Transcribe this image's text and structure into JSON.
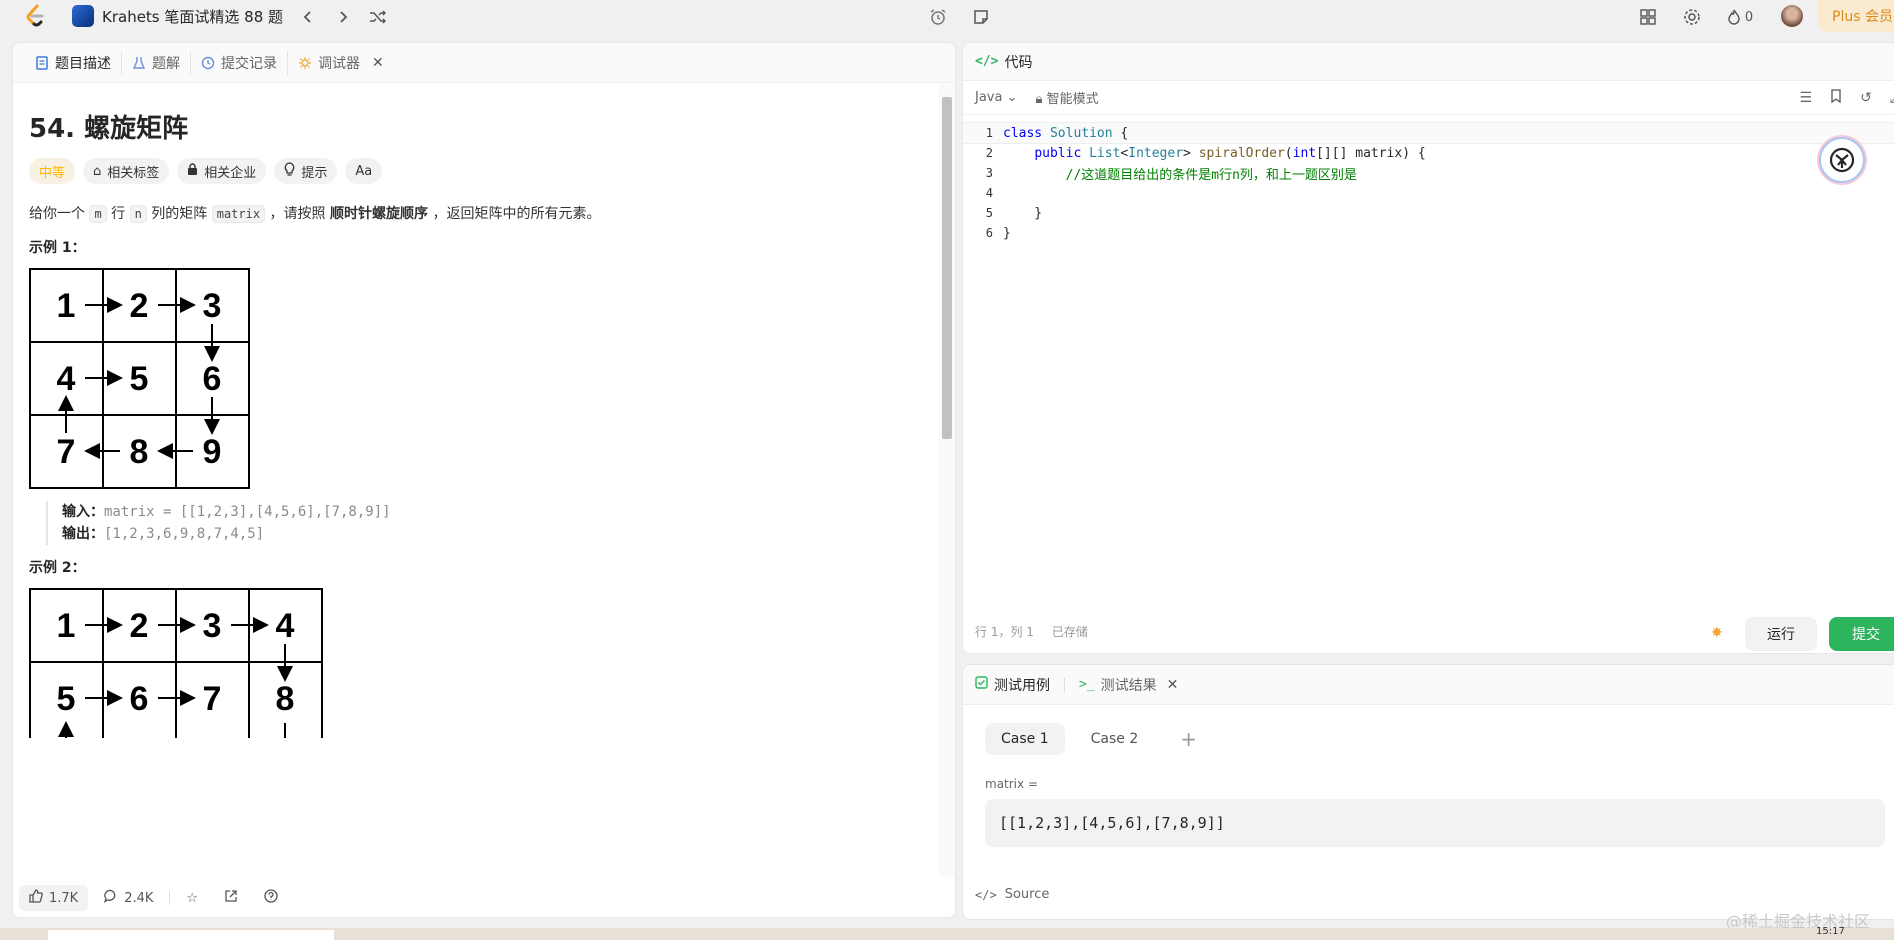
{
  "topbar": {
    "list_title": "Krahets 笔面试精选 88 题",
    "streak_count": "0",
    "plus_label": "Plus 会员"
  },
  "left_tabs": [
    {
      "label": "题目描述",
      "icon": "description-icon"
    },
    {
      "label": "题解",
      "icon": "flask-icon"
    },
    {
      "label": "提交记录",
      "icon": "history-icon"
    },
    {
      "label": "调试器",
      "icon": "debugger-icon"
    }
  ],
  "problem": {
    "title": "54. 螺旋矩阵",
    "difficulty": "中等",
    "badges": [
      "相关标签",
      "相关企业",
      "提示"
    ],
    "font_badge": "Aa",
    "desc_pre": "给你一个",
    "desc_m": "m",
    "desc_mid1": "行",
    "desc_n": "n",
    "desc_mid2": "列的矩阵",
    "desc_matrix": "matrix",
    "desc_mid3": "，请按照",
    "desc_bold": "顺时针螺旋顺序",
    "desc_post": "，返回矩阵中的所有元素。"
  },
  "example1": {
    "heading": "示例 1：",
    "grid": [
      "1",
      "2",
      "3",
      "4",
      "5",
      "6",
      "7",
      "8",
      "9"
    ],
    "input_label": "输入：",
    "input_value": "matrix = [[1,2,3],[4,5,6],[7,8,9]]",
    "output_label": "输出：",
    "output_value": "[1,2,3,6,9,8,7,4,5]"
  },
  "example2": {
    "heading": "示例 2：",
    "grid": [
      "1",
      "2",
      "3",
      "4",
      "5",
      "6",
      "7",
      "8"
    ]
  },
  "bottombar": {
    "likes": "1.7K",
    "comments": "2.4K"
  },
  "editor": {
    "header": "代码",
    "language": "Java",
    "mode": "智能模式",
    "lines": [
      {
        "n": "1",
        "parts": [
          {
            "c": "kw",
            "t": "class "
          },
          {
            "c": "ty",
            "t": "Solution"
          },
          {
            "c": "pl",
            "t": " {"
          }
        ]
      },
      {
        "n": "2",
        "parts": [
          {
            "c": "pl",
            "t": "    "
          },
          {
            "c": "kw",
            "t": "public "
          },
          {
            "c": "ty",
            "t": "List"
          },
          {
            "c": "pl",
            "t": "<"
          },
          {
            "c": "ty",
            "t": "Integer"
          },
          {
            "c": "pl",
            "t": "> "
          },
          {
            "c": "fn",
            "t": "spiralOrder"
          },
          {
            "c": "pl",
            "t": "("
          },
          {
            "c": "kw",
            "t": "int"
          },
          {
            "c": "pl",
            "t": "[][] matrix) {"
          }
        ]
      },
      {
        "n": "3",
        "parts": [
          {
            "c": "pl",
            "t": "        "
          },
          {
            "c": "cm",
            "t": "//这道题目给出的条件是m行n列，和上一题区别是"
          }
        ]
      },
      {
        "n": "4",
        "parts": []
      },
      {
        "n": "5",
        "parts": [
          {
            "c": "pl",
            "t": "    }"
          }
        ]
      },
      {
        "n": "6",
        "parts": [
          {
            "c": "pl",
            "t": "}"
          }
        ]
      }
    ],
    "status_pos": "行 1，列 1",
    "status_saved": "已存储",
    "run_label": "运行",
    "submit_label": "提交"
  },
  "testpanel": {
    "tab_cases": "测试用例",
    "tab_results": "测试结果",
    "cases": [
      "Case 1",
      "Case 2"
    ],
    "param_label": "matrix =",
    "param_value": "[[1,2,3],[4,5,6],[7,8,9]]",
    "source_label": "Source"
  },
  "watermark": "@稀土掘金技术社区",
  "clock": "15:17"
}
